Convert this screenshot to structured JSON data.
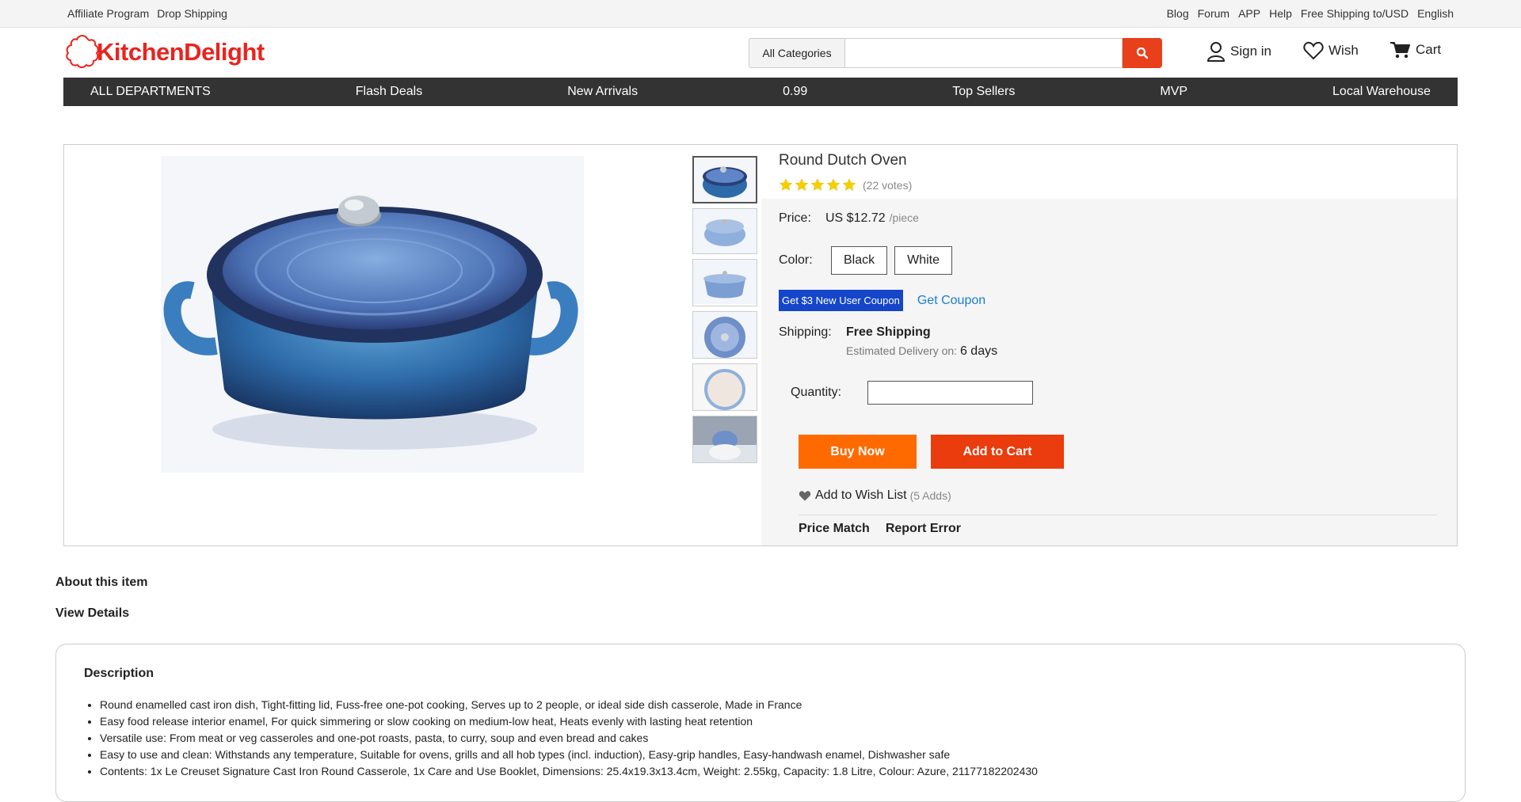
{
  "topbar": {
    "left": [
      "Affiliate Program",
      "Drop Shipping"
    ],
    "right": [
      "Blog",
      "Forum",
      "APP",
      "Help",
      "Free Shipping to/USD",
      "English"
    ]
  },
  "header": {
    "logo_text": "KitchenDelight",
    "category_select": "All Categories",
    "search_value": "",
    "sign_in": "Sign in",
    "wish": "Wish",
    "cart": "Cart"
  },
  "nav": [
    "ALL DEPARTMENTS",
    "Flash Deals",
    "New Arrivals",
    "0.99",
    "Top Sellers",
    "MVP",
    "Local Warehouse"
  ],
  "product": {
    "title": "Round Dutch Oven",
    "rating_stars": 5,
    "votes": "(22 votes)",
    "price_label": "Price:",
    "price": "US $12.72",
    "unit": "/piece",
    "color_label": "Color:",
    "colors": [
      "Black",
      "White"
    ],
    "coupon_badge": "Get $3 New User Coupon",
    "coupon_link": "Get Coupon",
    "shipping_label": "Shipping:",
    "shipping_value": "Free Shipping",
    "delivery_label": "Estimated Delivery on:",
    "delivery_value": "6 days",
    "quantity_label": "Quantity:",
    "quantity_value": "",
    "buy_now": "Buy Now",
    "add_to_cart": "Add to Cart",
    "add_wish": "Add to Wish List",
    "wish_count": "(5 Adds)",
    "price_match": "Price Match",
    "report_error": "Report Error",
    "accent_orange": "#ff6a00",
    "accent_red": "#ea3c0c"
  },
  "about": "About this item",
  "view_details": "View Details",
  "description": {
    "title": "Description",
    "items": [
      "Round enamelled cast iron dish, Tight-fitting lid, Fuss-free one-pot cooking, Serves up to 2 people, or ideal side dish casserole, Made in France",
      "Easy food release interior enamel, For quick simmering or slow cooking on medium-low heat, Heats evenly with lasting heat retention",
      "Versatile use: From meat or veg casseroles and one-pot roasts, pasta, to curry, soup and even bread and cakes",
      "Easy to use and clean: Withstands any temperature, Suitable for ovens, grills and all hob types (incl. induction), Easy-grip handles, Easy-handwash enamel, Dishwasher safe",
      "Contents: 1x Le Creuset Signature Cast Iron Round Casserole, 1x Care and Use Booklet, Dimensions: 25.4x19.3x13.4cm, Weight: 2.55kg, Capacity: 1.8 Litre, Colour: Azure, 21177182202430"
    ]
  }
}
